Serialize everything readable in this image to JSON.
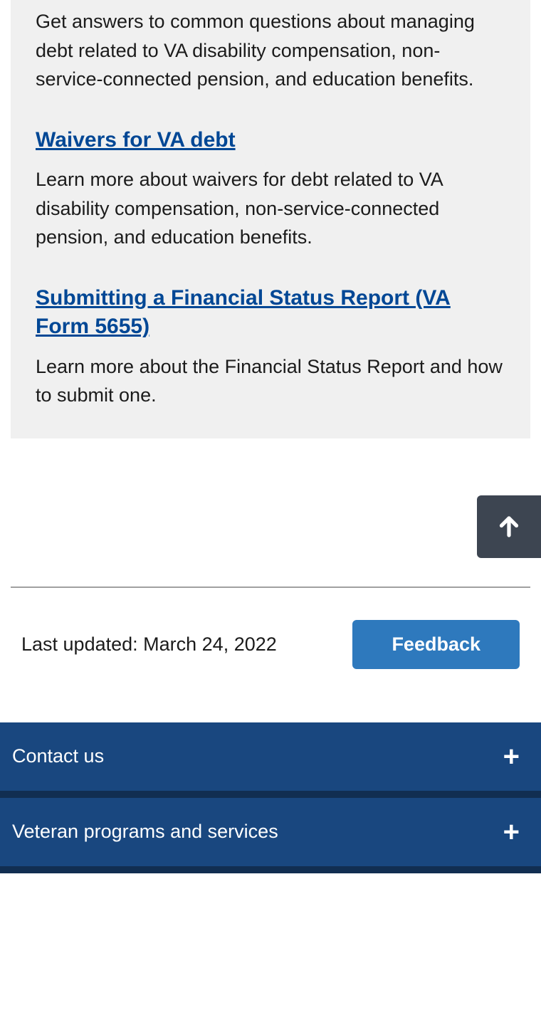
{
  "content": {
    "intro": "Get answers to common questions about managing debt related to VA disability compensation, non-service-connected pension, and education benefits.",
    "links": [
      {
        "title": "Waivers for VA debt",
        "desc": "Learn more about waivers for debt related to VA disability compensation, non-service-connected pension, and education benefits."
      },
      {
        "title": "Submitting a Financial Status Report (VA Form 5655)",
        "desc": "Learn more about the Financial Status Report and how to submit one."
      }
    ]
  },
  "meta": {
    "last_updated_label": "Last updated: ",
    "last_updated_date": "March 24, 2022",
    "feedback_label": "Feedback"
  },
  "footer": {
    "items": [
      {
        "label": "Contact us"
      },
      {
        "label": "Veteran programs and services"
      }
    ]
  }
}
